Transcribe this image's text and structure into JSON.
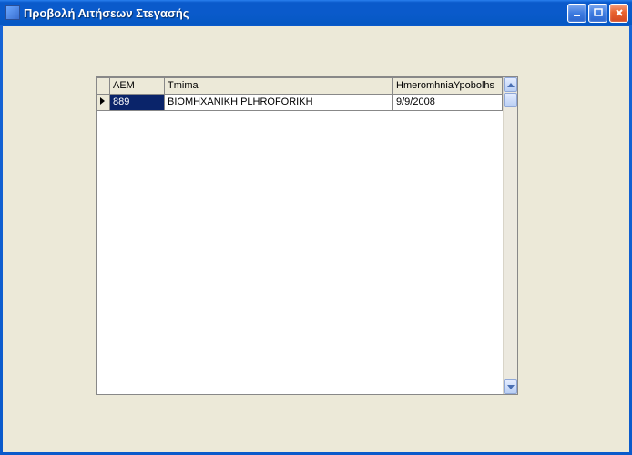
{
  "window": {
    "title": "Προβολή Αιτήσεων Στεγασής"
  },
  "grid": {
    "columns": {
      "aem": "AEM",
      "tmima": "Tmima",
      "date": "HmeromhniaYpobolhs"
    },
    "rows": [
      {
        "aem": "889",
        "tmima": "BIOMHXANIKH PLHROFORIKH",
        "date": "9/9/2008"
      }
    ]
  }
}
